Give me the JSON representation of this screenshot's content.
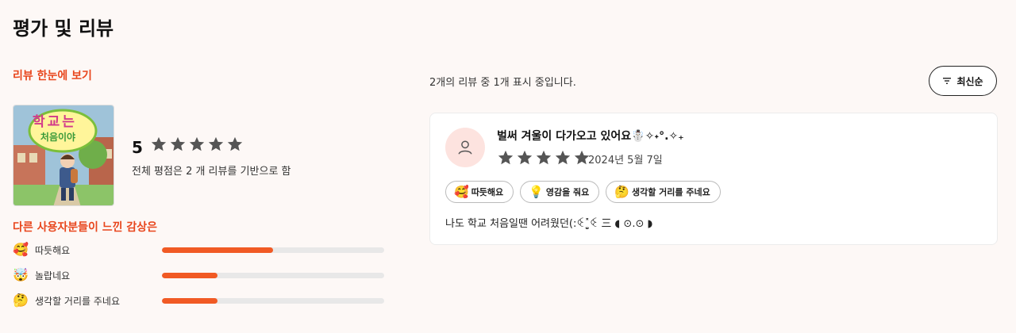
{
  "page": {
    "title": "평가 및 리뷰"
  },
  "summary": {
    "section_label": "리뷰 한눈에 보기",
    "book_cover_title_line1": "학교는",
    "book_cover_title_line2": "처음이야",
    "rating": "5",
    "star_count": 5,
    "basis_text": "전체 평점은 2 개 리뷰를 기반으로 함"
  },
  "emotions": {
    "section_label": "다른 사용자분들이 느낀 감상은",
    "items": [
      {
        "icon": "🥰",
        "icon_name": "heart-face-icon",
        "label": "따듯해요",
        "ratio": 0.5
      },
      {
        "icon": "🤯",
        "icon_name": "mind-blown-icon",
        "label": "놀랍네요",
        "ratio": 0.25
      },
      {
        "icon": "🤔",
        "icon_name": "thinking-face-icon",
        "label": "생각할 거리를 주네요",
        "ratio": 0.25
      }
    ],
    "bar_color": "#f15a24"
  },
  "reviews": {
    "count_text": "2개의 리뷰 중 1개 표시 중입니다.",
    "sort_label": "최신순",
    "items": [
      {
        "title": "벌써 겨울이 다가오고 있어요☃️✧˖°.✧₊",
        "stars": 5,
        "date": "2024년 5월 7일",
        "tags": [
          {
            "icon": "🥰",
            "label": "따듯해요"
          },
          {
            "icon": "💡",
            "label": "영감을 줘요"
          },
          {
            "icon": "🤔",
            "label": "생각할 거리를 주네요"
          }
        ],
        "body": "나도 학교 처음일땐 어려웠던(:ꒊ˟͈̮ꒊ 三 ◖ ⊙.⊙ ◗"
      }
    ]
  },
  "colors": {
    "accent": "#e8461d",
    "star": "#555555"
  }
}
